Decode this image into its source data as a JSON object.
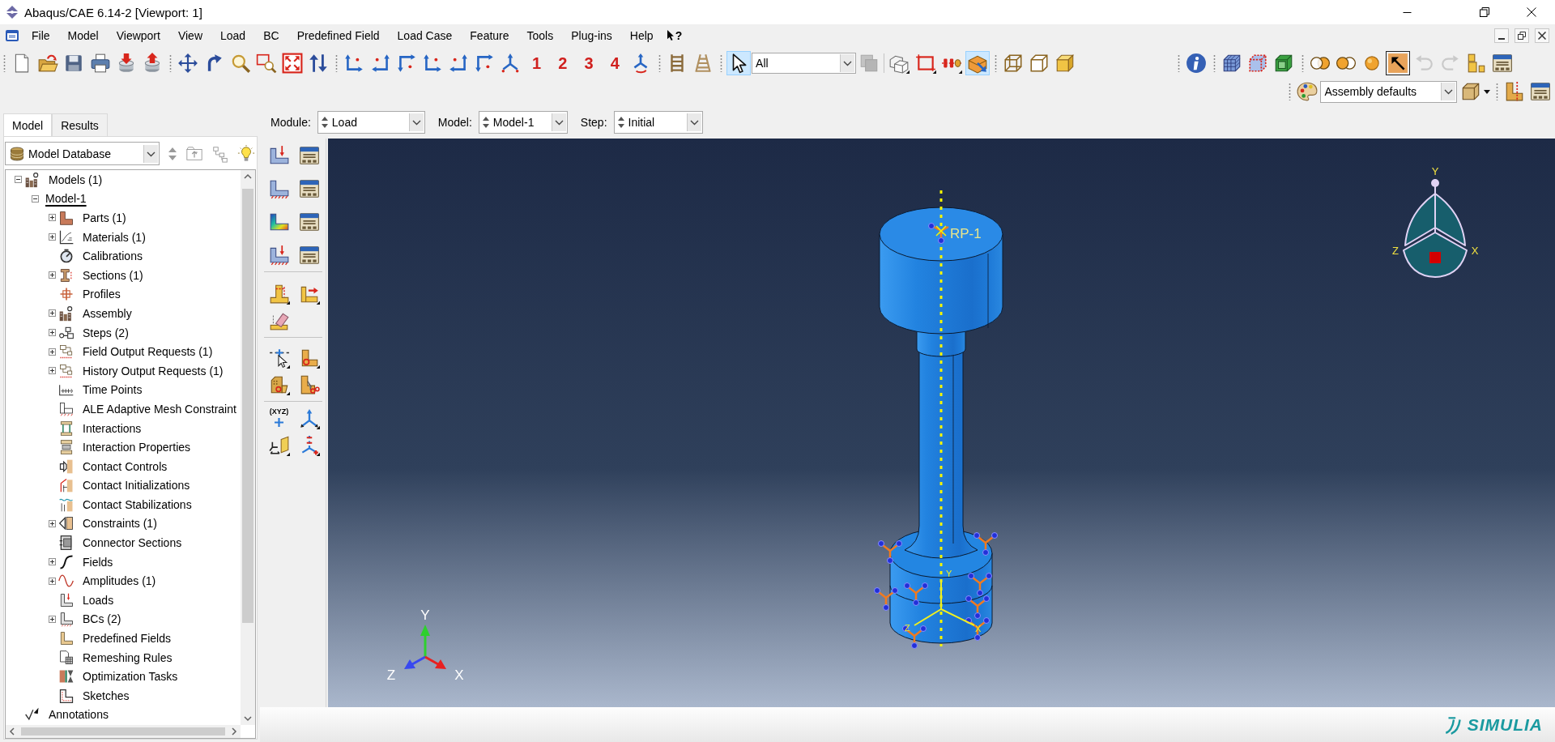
{
  "window": {
    "title": "Abaqus/CAE 6.14-2 [Viewport: 1]"
  },
  "menu_bar": {
    "items": [
      "File",
      "Model",
      "Viewport",
      "View",
      "Load",
      "BC",
      "Predefined Field",
      "Load Case",
      "Feature",
      "Tools",
      "Plug-ins",
      "Help"
    ],
    "whats_this": "?"
  },
  "toolbar": {
    "view_buttons": [
      "1",
      "2",
      "3",
      "4"
    ],
    "select_pressed": true,
    "selection_filter": "All",
    "stack_disabled": true,
    "box_arrow_pressed": true,
    "cursor_box_pressed": true,
    "undo_disabled": true,
    "redo_disabled": true,
    "render_style": "Assembly defaults"
  },
  "context_bar": [
    {
      "label": "Module:",
      "value": "Load"
    },
    {
      "label": "Model:",
      "value": "Model-1"
    },
    {
      "label": "Step:",
      "value": "Initial"
    }
  ],
  "model_tree": {
    "tabs": [
      {
        "label": "Model",
        "selected": true
      },
      {
        "label": "Results",
        "selected": false
      }
    ],
    "source": "Model Database",
    "items": [
      {
        "label": "Models (1)",
        "expanded": true,
        "children": [
          {
            "label": "Model-1",
            "expanded": true,
            "current": true,
            "children": [
              {
                "label": "Parts (1)",
                "expanded": false
              },
              {
                "label": "Materials (1)",
                "expanded": false
              },
              {
                "label": "Calibrations"
              },
              {
                "label": "Sections (1)",
                "expanded": false
              },
              {
                "label": "Profiles"
              },
              {
                "label": "Assembly",
                "expanded": false
              },
              {
                "label": "Steps (2)",
                "expanded": false
              },
              {
                "label": "Field Output Requests (1)",
                "expanded": false
              },
              {
                "label": "History Output Requests (1)",
                "expanded": false
              },
              {
                "label": "Time Points"
              },
              {
                "label": "ALE Adaptive Mesh Constraint"
              },
              {
                "label": "Interactions"
              },
              {
                "label": "Interaction Properties"
              },
              {
                "label": "Contact Controls"
              },
              {
                "label": "Contact Initializations"
              },
              {
                "label": "Contact Stabilizations"
              },
              {
                "label": "Constraints (1)",
                "expanded": false
              },
              {
                "label": "Connector Sections"
              },
              {
                "label": "Fields",
                "expanded": false
              },
              {
                "label": "Amplitudes (1)",
                "expanded": false
              },
              {
                "label": "Loads"
              },
              {
                "label": "BCs (2)",
                "expanded": false
              },
              {
                "label": "Predefined Fields"
              },
              {
                "label": "Remeshing Rules"
              },
              {
                "label": "Optimization Tasks"
              },
              {
                "label": "Sketches"
              }
            ]
          }
        ]
      },
      {
        "label": "Annotations"
      }
    ]
  },
  "toolbox": {
    "point_label": "(XYZ)"
  },
  "viewport": {
    "reference_point": "RP-1",
    "part_axes": {
      "y": "Y",
      "z": "Z",
      "x": "X"
    },
    "global_axes": {
      "y": "Y",
      "z": "Z",
      "x": "X"
    },
    "view_cube": {
      "y": "Y",
      "z": "Z",
      "x": "X"
    }
  },
  "status_bar": {
    "brand": "SIMULIA"
  }
}
